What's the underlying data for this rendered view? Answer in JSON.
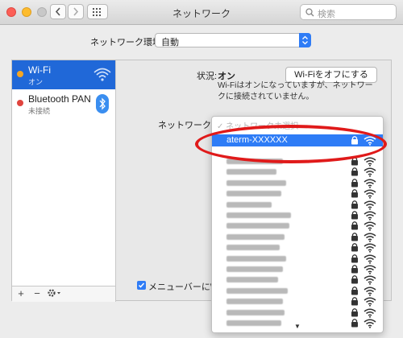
{
  "window": {
    "title": "ネットワーク"
  },
  "search": {
    "placeholder": "検索"
  },
  "location": {
    "label": "ネットワーク環境:",
    "value": "自動"
  },
  "services": [
    {
      "name": "Wi-Fi",
      "status": "オン",
      "status_color": "#f5a623",
      "icon": "wifi-icon"
    },
    {
      "name": "Bluetooth PAN",
      "status": "未接続",
      "status_color": "#e0443e",
      "icon": "bluetooth-icon"
    }
  ],
  "status": {
    "label": "状況:",
    "value": "オン",
    "button": "Wi-Fiをオフにする",
    "description": "Wi-Fiはオンになっていますが、ネットワークに接続されていません。"
  },
  "network_name": {
    "label": "ネットワーク名",
    "list_header": "✓ ネットワーク未選択",
    "selected": "aterm-XXXXXX",
    "other_network_count": 16
  },
  "show_in_menubar": {
    "label": "メニューバーにWi-"
  },
  "colors": {
    "accent": "#2e7cf6",
    "annotation": "#e01a1a"
  }
}
